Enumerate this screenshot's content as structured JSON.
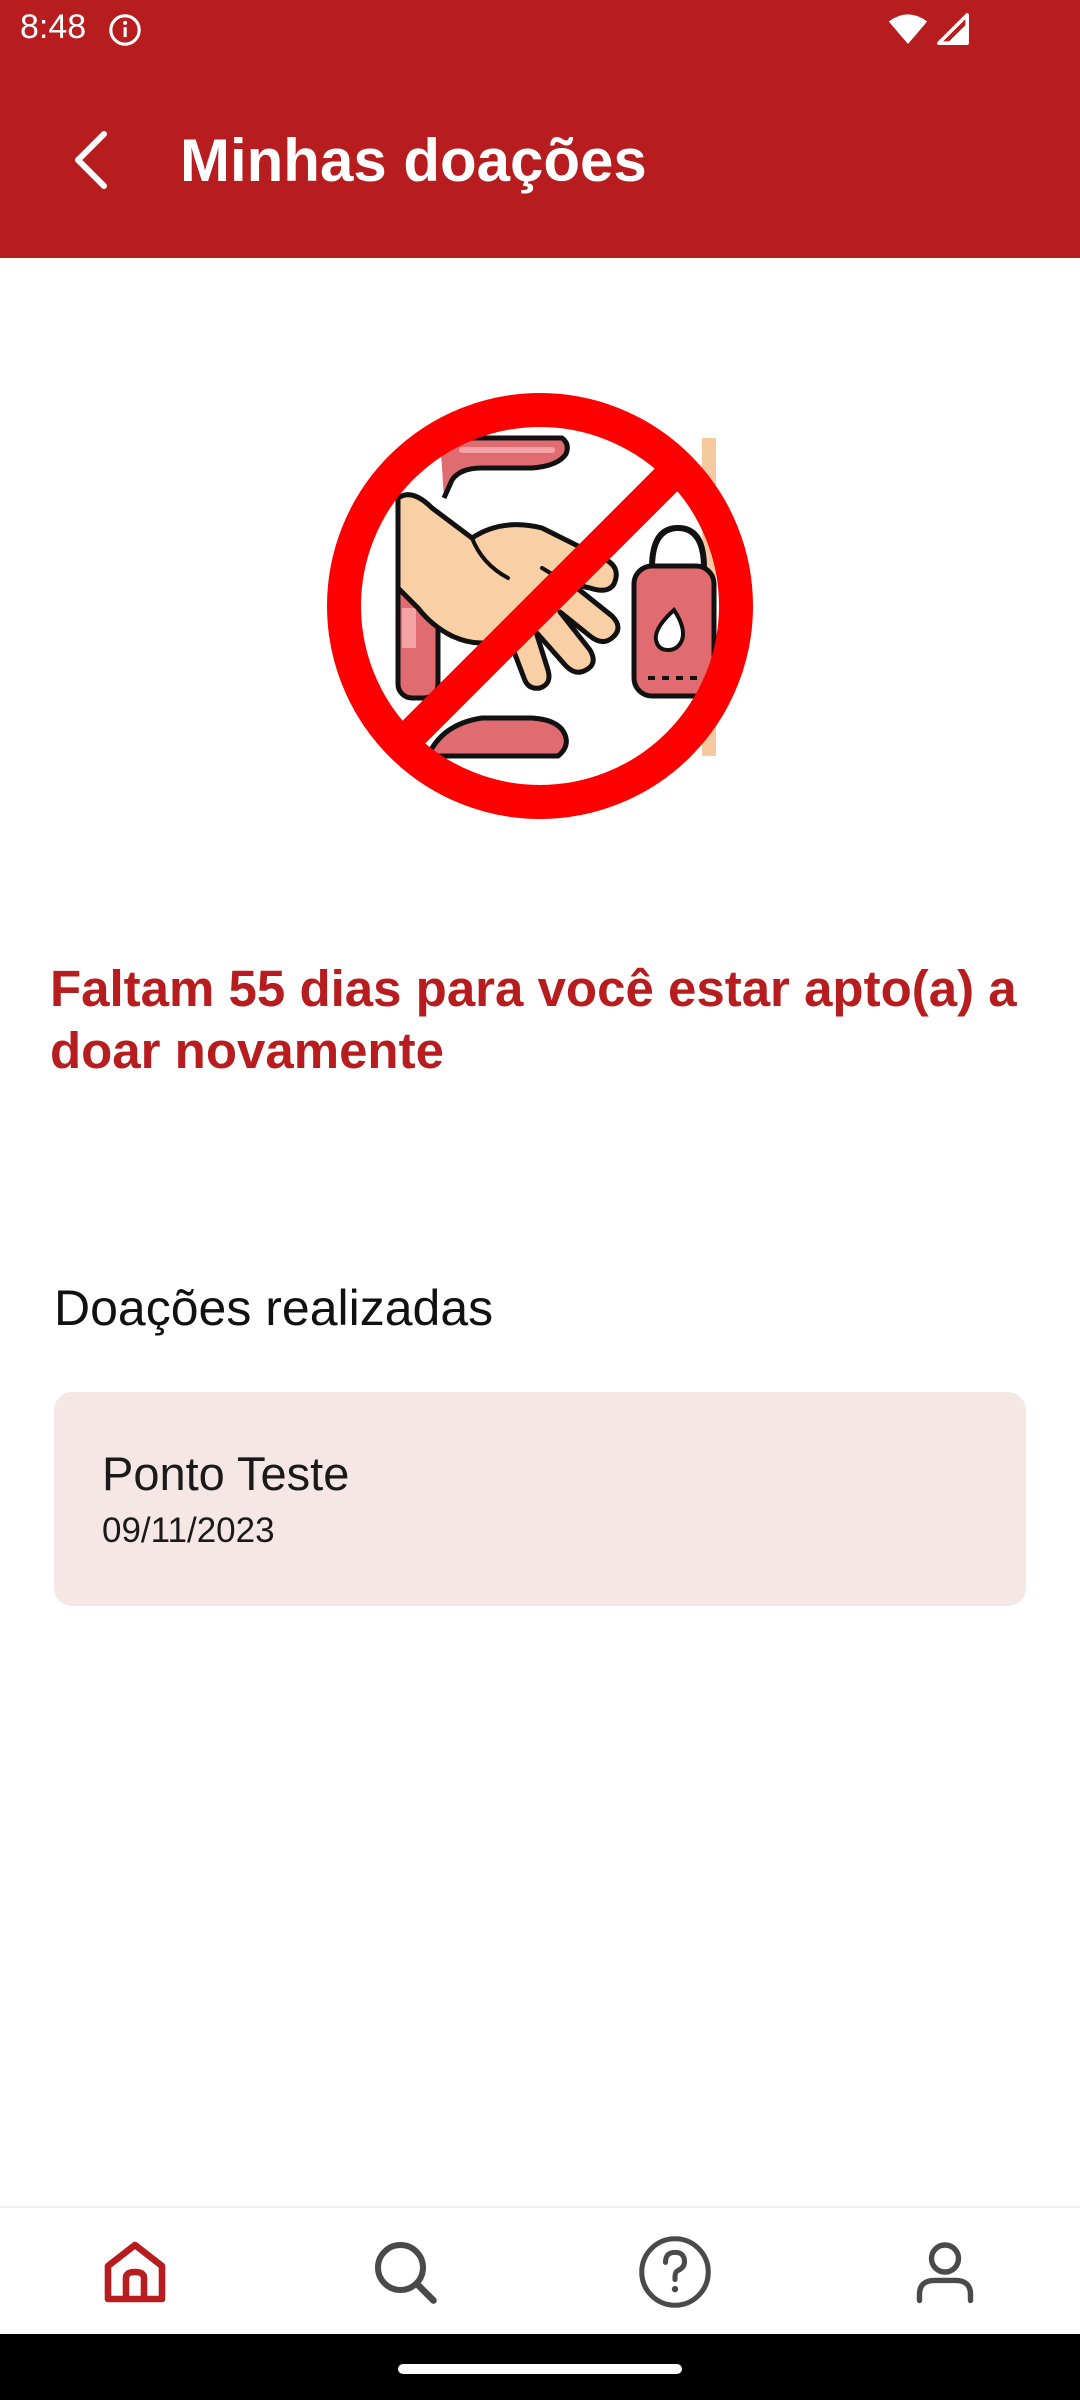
{
  "status_bar": {
    "time": "8:48",
    "icons": [
      "info-icon",
      "wifi-icon",
      "signal-icon"
    ]
  },
  "app_bar": {
    "back_icon": "chevron-left-icon",
    "title": "Minhas doações"
  },
  "illustration": {
    "icon": "no-donation-icon"
  },
  "eligibility": {
    "message": "Faltam 55 dias para você estar apto(a) a doar novamente"
  },
  "donations": {
    "section_title": "Doações realizadas",
    "items": [
      {
        "place": "Ponto Teste",
        "date": "09/11/2023"
      }
    ]
  },
  "bottom_nav": {
    "items": [
      {
        "icon": "home-icon",
        "active": true
      },
      {
        "icon": "search-icon",
        "active": false
      },
      {
        "icon": "help-icon",
        "active": false
      },
      {
        "icon": "profile-icon",
        "active": false
      }
    ]
  },
  "colors": {
    "primary": "#b71c1e",
    "card_background": "#f6e7e7",
    "nav_active": "#b71c1e",
    "nav_inactive": "#4a4a4a"
  }
}
